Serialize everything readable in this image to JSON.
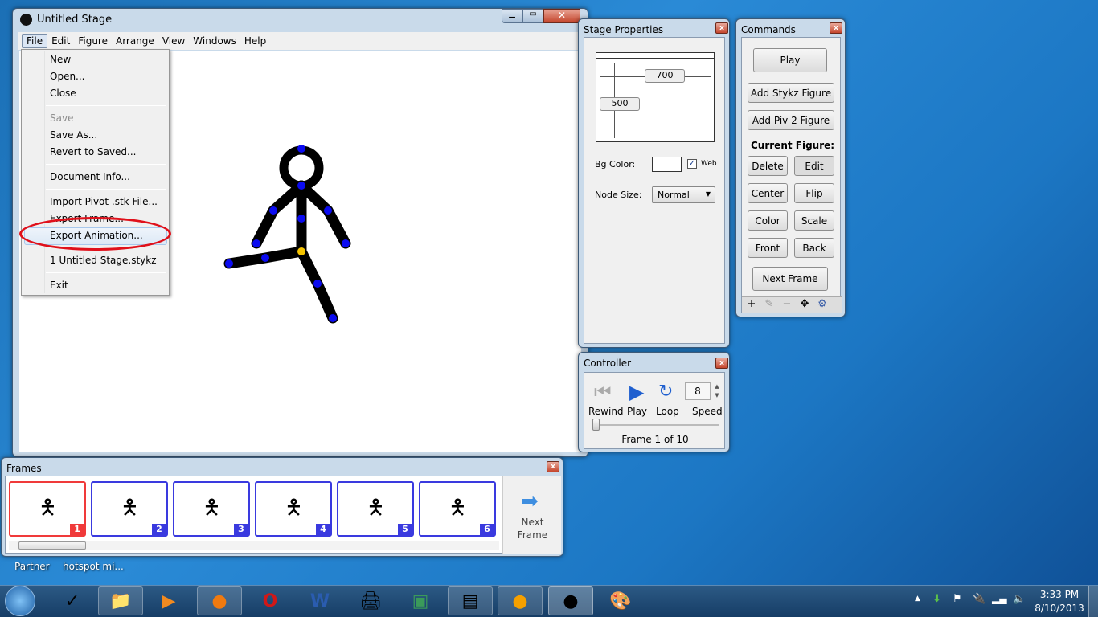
{
  "window": {
    "title": "Untitled Stage",
    "menu": [
      "File",
      "Edit",
      "Figure",
      "Arrange",
      "View",
      "Windows",
      "Help"
    ]
  },
  "file_menu": {
    "items": [
      {
        "label": "New",
        "enabled": true
      },
      {
        "label": "Open...",
        "enabled": true
      },
      {
        "label": "Close",
        "enabled": true
      },
      {
        "label": "Save",
        "enabled": false
      },
      {
        "label": "Save As...",
        "enabled": true
      },
      {
        "label": "Revert to Saved...",
        "enabled": true
      },
      {
        "label": "Document Info...",
        "enabled": true
      },
      {
        "label": "Import Pivot .stk File...",
        "enabled": true
      },
      {
        "label": "Export Frame...",
        "enabled": true
      },
      {
        "label": "Export Animation...",
        "enabled": true,
        "highlighted": true
      },
      {
        "label": "1 Untitled Stage.stykz",
        "enabled": true
      },
      {
        "label": "Exit",
        "enabled": true
      }
    ]
  },
  "stage_properties": {
    "title": "Stage Properties",
    "width": "700",
    "height": "500",
    "bg_color_label": "Bg Color:",
    "web_label": "Web",
    "web_checked": true,
    "node_size_label": "Node Size:",
    "node_size": "Normal"
  },
  "commands": {
    "title": "Commands",
    "play": "Play",
    "add_stykz": "Add Stykz Figure",
    "add_piv": "Add Piv 2 Figure",
    "current_figure": "Current Figure:",
    "delete": "Delete",
    "edit": "Edit",
    "center": "Center",
    "flip": "Flip",
    "color": "Color",
    "scale": "Scale",
    "front": "Front",
    "back": "Back",
    "next_frame": "Next Frame"
  },
  "controller": {
    "title": "Controller",
    "rewind": "Rewind",
    "play": "Play",
    "loop": "Loop",
    "speed_label": "Speed",
    "speed": "8",
    "frame_status": "Frame 1 of 10"
  },
  "frames": {
    "title": "Frames",
    "items": [
      "1",
      "2",
      "3",
      "4",
      "5",
      "6"
    ],
    "selected": "1",
    "next_line1": "Next",
    "next_line2": "Frame"
  },
  "desktop": {
    "labels": [
      "Partner",
      "hotspot mi..."
    ]
  },
  "taskbar": {
    "time": "3:33 PM",
    "date": "8/10/2013"
  },
  "colors": {
    "selected_frame": "#f03a3a",
    "frame_border": "#3a3adf",
    "annotation": "#e0101a"
  }
}
